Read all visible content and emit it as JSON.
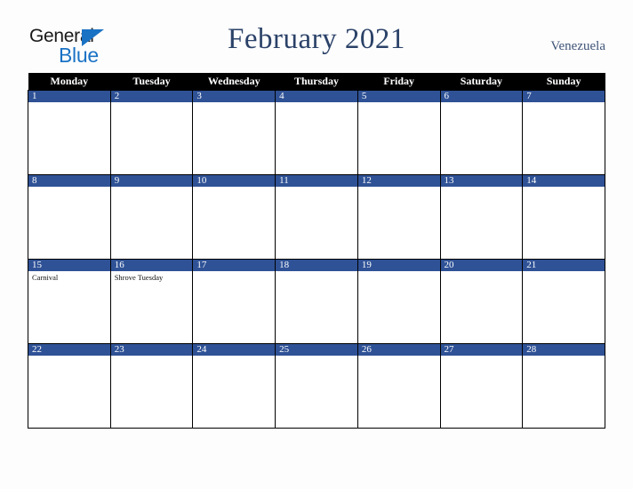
{
  "brand": {
    "name_top": "General",
    "name_bottom": "Blue",
    "triangle_color": "#1a72c4",
    "text_color": "#1a1a1a"
  },
  "header": {
    "title": "February 2021",
    "country": "Venezuela",
    "title_color": "#2b4268",
    "country_color": "#3f5577"
  },
  "calendar": {
    "accent_color": "#2f5296",
    "header_bg": "#000000",
    "header_fg": "#ffffff",
    "weekday_headers": [
      "Monday",
      "Tuesday",
      "Wednesday",
      "Thursday",
      "Friday",
      "Saturday",
      "Sunday"
    ],
    "weeks": [
      [
        {
          "day": "1",
          "events": []
        },
        {
          "day": "2",
          "events": []
        },
        {
          "day": "3",
          "events": []
        },
        {
          "day": "4",
          "events": []
        },
        {
          "day": "5",
          "events": []
        },
        {
          "day": "6",
          "events": []
        },
        {
          "day": "7",
          "events": []
        }
      ],
      [
        {
          "day": "8",
          "events": []
        },
        {
          "day": "9",
          "events": []
        },
        {
          "day": "10",
          "events": []
        },
        {
          "day": "11",
          "events": []
        },
        {
          "day": "12",
          "events": []
        },
        {
          "day": "13",
          "events": []
        },
        {
          "day": "14",
          "events": []
        }
      ],
      [
        {
          "day": "15",
          "events": [
            "Carnival"
          ]
        },
        {
          "day": "16",
          "events": [
            "Shrove Tuesday"
          ]
        },
        {
          "day": "17",
          "events": []
        },
        {
          "day": "18",
          "events": []
        },
        {
          "day": "19",
          "events": []
        },
        {
          "day": "20",
          "events": []
        },
        {
          "day": "21",
          "events": []
        }
      ],
      [
        {
          "day": "22",
          "events": []
        },
        {
          "day": "23",
          "events": []
        },
        {
          "day": "24",
          "events": []
        },
        {
          "day": "25",
          "events": []
        },
        {
          "day": "26",
          "events": []
        },
        {
          "day": "27",
          "events": []
        },
        {
          "day": "28",
          "events": []
        }
      ]
    ]
  }
}
